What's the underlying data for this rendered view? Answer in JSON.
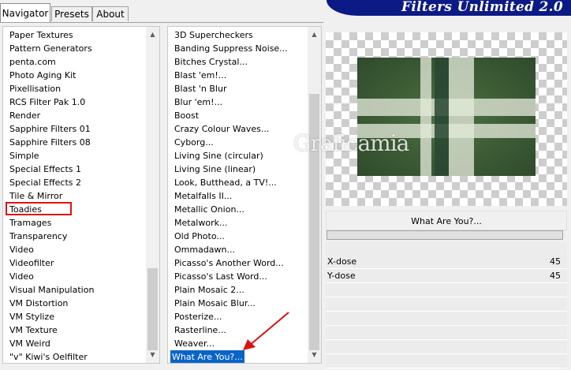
{
  "tabs": [
    "Navigator",
    "Presets",
    "About"
  ],
  "banner_title": "Filters Unlimited 2.0",
  "categories": [
    "Paper Textures",
    "Pattern Generators",
    "penta.com",
    "Photo Aging Kit",
    "Pixellisation",
    "RCS Filter Pak 1.0",
    "Render",
    "Sapphire Filters 01",
    "Sapphire Filters 08",
    "Simple",
    "Special Effects 1",
    "Special Effects 2",
    "Tile & Mirror",
    "Toadies",
    "Tramages",
    "Transparency",
    "Video",
    "Videofilter",
    "Video",
    "Visual Manipulation",
    "VM Distortion",
    "VM Stylize",
    "VM Texture",
    "VM Weird",
    "\"v\" Kiwi's Oelfilter"
  ],
  "filters": [
    "3D Supercheckers",
    "Banding Suppress Noise...",
    "Bitches Crystal...",
    "Blast 'em!...",
    "Blast 'n Blur",
    "Blur 'em!...",
    "Boost",
    "Crazy Colour Waves...",
    "Cyborg...",
    "Living Sine (circular)",
    "Living Sine (linear)",
    "Look, Butthead, a TV!...",
    "Metalfalls II...",
    "Metallic Onion...",
    "Metalwork...",
    "Old Photo...",
    "Ommadawn...",
    "Picasso's Another Word...",
    "Picasso's Last Word...",
    "Plain Mosaic 2...",
    "Plain Mosaic Blur...",
    "Posterize...",
    "Rasterline...",
    "Weaver...",
    "What Are You?..."
  ],
  "selected_filter": "What Are You?...",
  "highlighted_category": "Toadies",
  "watermark": "Graficamia",
  "filter_name": "What Are You?...",
  "params": [
    {
      "label": "X-dose",
      "value": "45"
    },
    {
      "label": "Y-dose",
      "value": "45"
    }
  ],
  "colors": {
    "banner": "#0c1a86",
    "selection": "#0a64c8",
    "annotation": "#e01010"
  }
}
